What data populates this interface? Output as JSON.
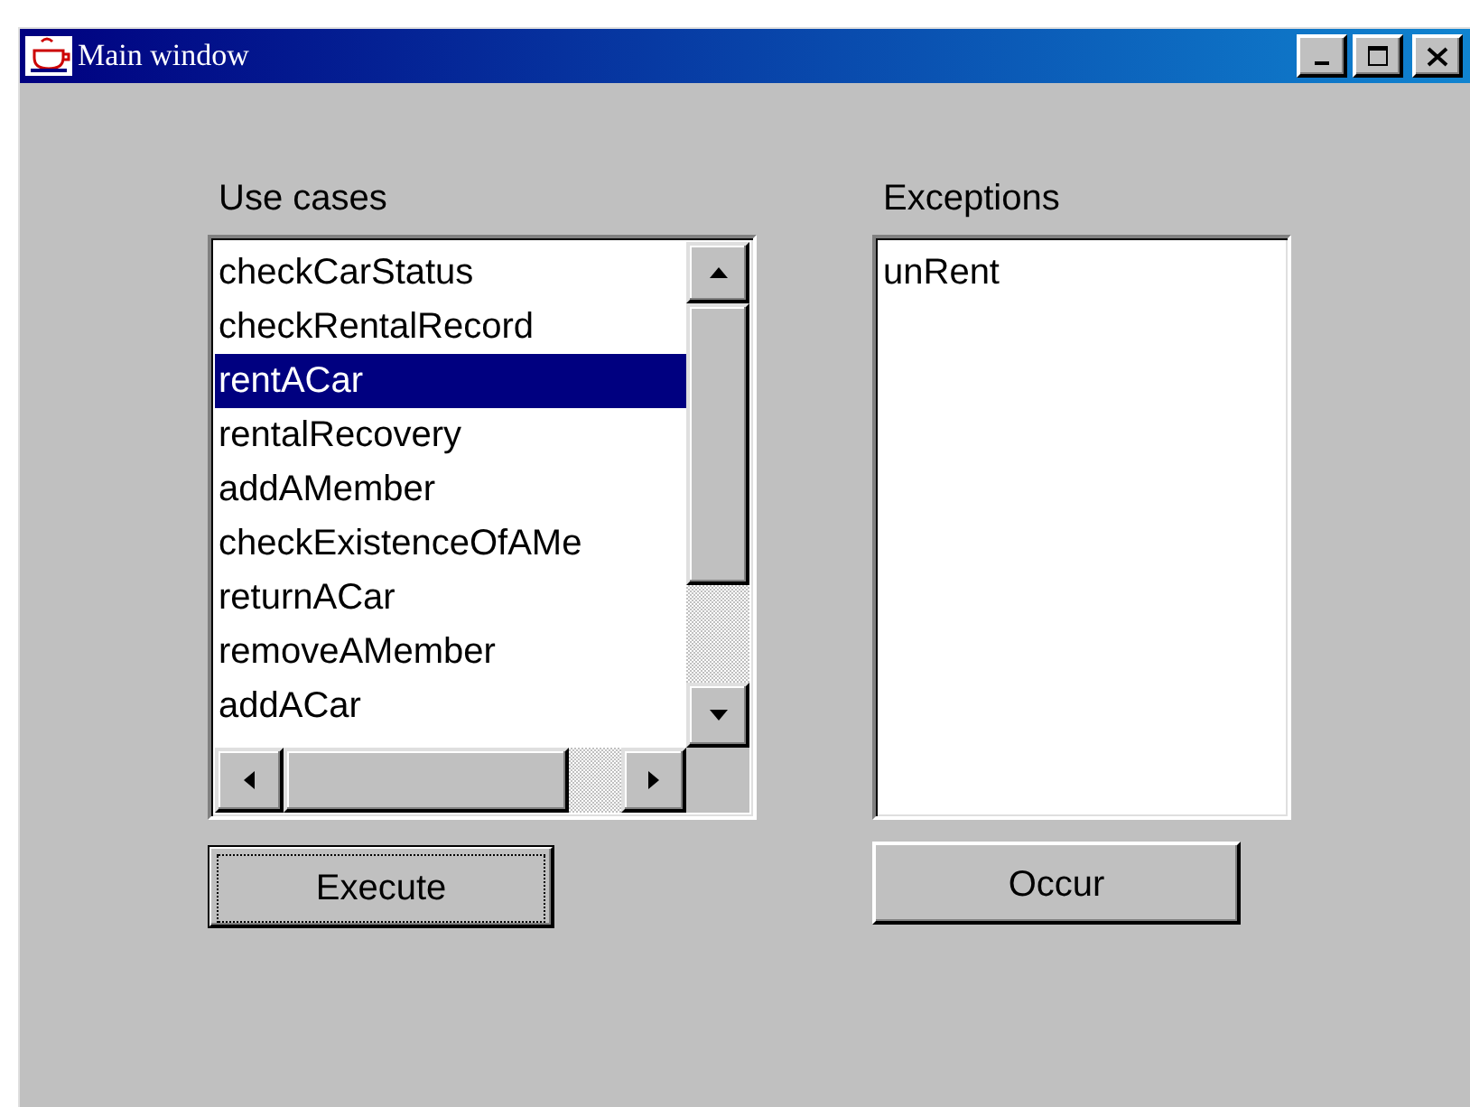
{
  "window": {
    "title": "Main window"
  },
  "use_cases": {
    "label": "Use cases",
    "items": [
      {
        "label": "checkCarStatus",
        "selected": false
      },
      {
        "label": "checkRentalRecord",
        "selected": false
      },
      {
        "label": "rentACar",
        "selected": true
      },
      {
        "label": "rentalRecovery",
        "selected": false
      },
      {
        "label": "addAMember",
        "selected": false
      },
      {
        "label": "checkExistenceOfAMe",
        "selected": false
      },
      {
        "label": "returnACar",
        "selected": false
      },
      {
        "label": "removeAMember",
        "selected": false
      },
      {
        "label": "addACar",
        "selected": false
      }
    ]
  },
  "exceptions": {
    "label": "Exceptions",
    "items": [
      {
        "label": "unRent",
        "selected": false
      }
    ]
  },
  "buttons": [
    {
      "label": "Execute",
      "focused": true
    },
    {
      "label": "Occur",
      "focused": false
    }
  ]
}
